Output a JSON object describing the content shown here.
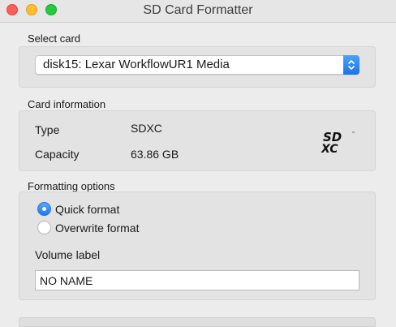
{
  "window": {
    "title": "SD Card Formatter"
  },
  "select_card": {
    "label": "Select card",
    "selected": "disk15: Lexar WorkflowUR1 Media"
  },
  "card_information": {
    "label": "Card information",
    "type_label": "Type",
    "type_value": "SDXC",
    "capacity_label": "Capacity",
    "capacity_value": "63.86 GB",
    "logo": {
      "top": "SD",
      "bottom": "XC",
      "tm": "™"
    }
  },
  "formatting_options": {
    "label": "Formatting options",
    "options": [
      {
        "label": "Quick format",
        "selected": true
      },
      {
        "label": "Overwrite format",
        "selected": false
      }
    ],
    "volume_label_title": "Volume label",
    "volume_label_value": "NO NAME"
  },
  "colors": {
    "accent": "#1f78ef",
    "close": "#fe5f57",
    "minimize": "#febc2e",
    "zoom": "#28c840"
  },
  "icons": {
    "select_stepper": "up-down-chevron-icon",
    "logo": "sdxc-logo-icon"
  }
}
